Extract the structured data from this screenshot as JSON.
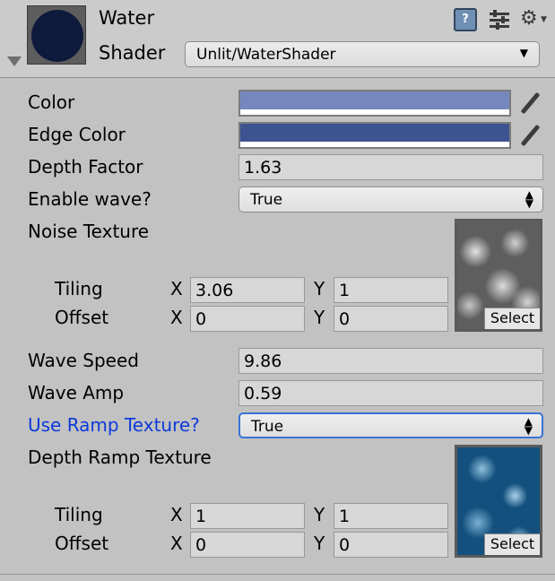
{
  "header": {
    "material_name": "Water",
    "shader_label": "Shader",
    "shader_value": "Unlit/WaterShader",
    "help_glyph": "?",
    "icons": [
      "book-help-icon",
      "sliders-icon",
      "gear-icon"
    ]
  },
  "properties": {
    "color": {
      "label": "Color",
      "swatch": "#7587bd"
    },
    "edge_color": {
      "label": "Edge Color",
      "swatch": "#3e5490"
    },
    "depth_factor": {
      "label": "Depth Factor",
      "value": "1.63"
    },
    "enable_wave": {
      "label": "Enable wave?",
      "value": "True"
    },
    "noise_texture": {
      "label": "Noise Texture",
      "tiling_label": "Tiling",
      "tiling_x": "3.06",
      "tiling_y": "1",
      "offset_label": "Offset",
      "offset_x": "0",
      "offset_y": "0",
      "select_label": "Select"
    },
    "wave_speed": {
      "label": "Wave Speed",
      "value": "9.86"
    },
    "wave_amp": {
      "label": "Wave Amp",
      "value": "0.59"
    },
    "use_ramp": {
      "label": "Use Ramp Texture?",
      "value": "True"
    },
    "depth_ramp": {
      "label": "Depth Ramp Texture",
      "tiling_label": "Tiling",
      "tiling_x": "1",
      "tiling_y": "1",
      "offset_label": "Offset",
      "offset_x": "0",
      "offset_y": "0",
      "select_label": "Select"
    }
  },
  "axes": {
    "x": "X",
    "y": "Y"
  },
  "glyphs": {
    "caret_down": "▼",
    "updown": "▲▼"
  },
  "colors": {
    "accent_blue": "#0d3ad8",
    "focus_border": "#3a72d4"
  }
}
